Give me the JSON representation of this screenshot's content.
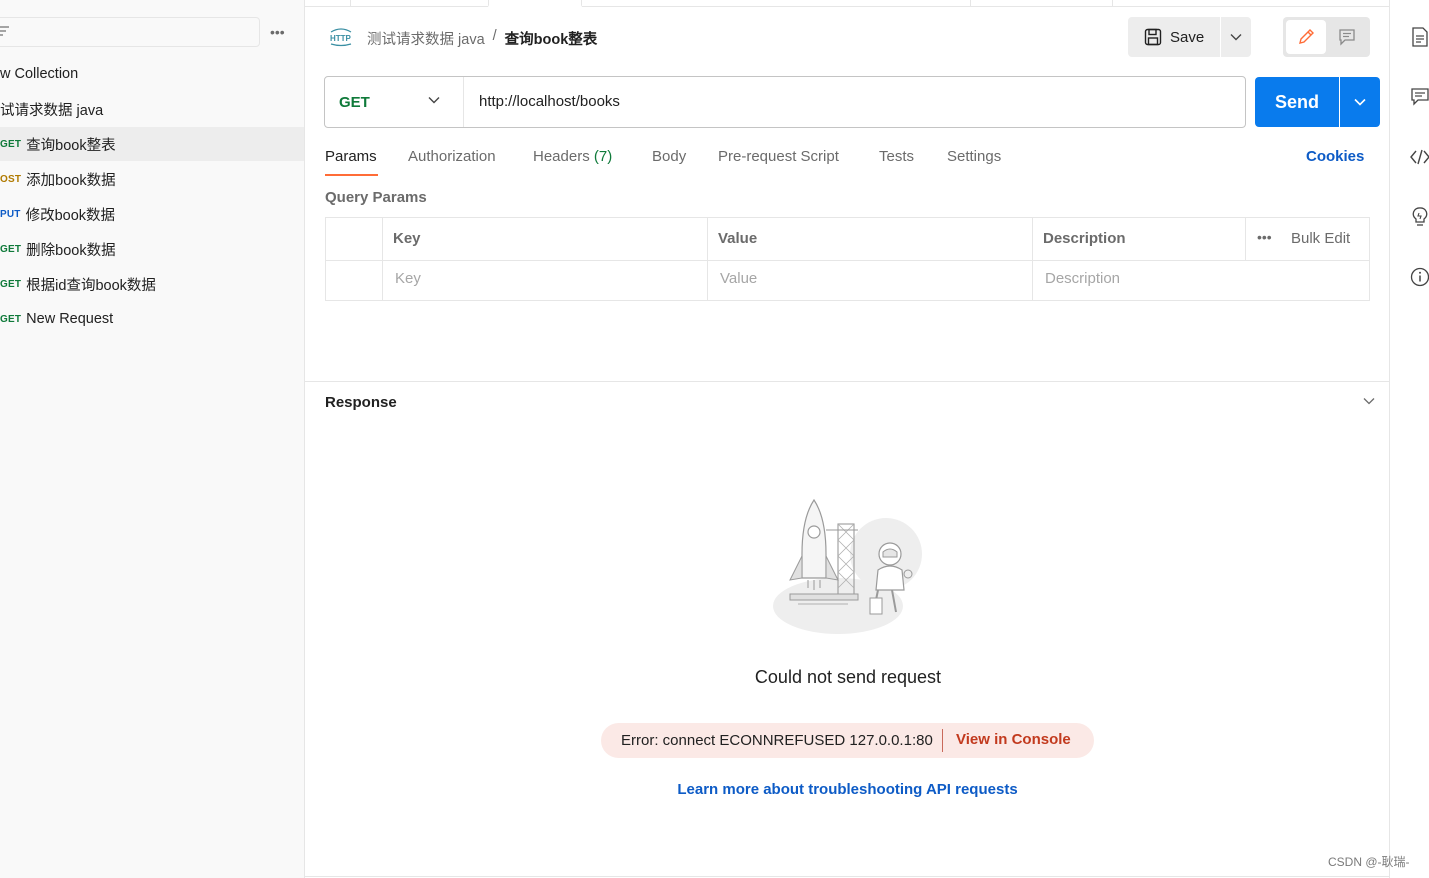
{
  "sidebar": {
    "more_label": "•••",
    "items": [
      {
        "method": "",
        "label": "w Collection"
      },
      {
        "method": "",
        "label": "试请求数据 java"
      },
      {
        "method": "GET",
        "label": "查询book整表"
      },
      {
        "method": "OST",
        "label": "添加book数据"
      },
      {
        "method": "PUT",
        "label": "修改book数据"
      },
      {
        "method": "GET",
        "label": "删除book数据"
      },
      {
        "method": "GET",
        "label": "根据id查询book数据"
      },
      {
        "method": "GET",
        "label": "New Request"
      }
    ]
  },
  "header": {
    "http_icon": "http-request-icon",
    "breadcrumb_parent": "测试请求数据 java",
    "breadcrumb_separator": "/",
    "breadcrumb_current": "查询book整表",
    "save_label": "Save"
  },
  "request": {
    "method": "GET",
    "url": "http://localhost/books",
    "send_label": "Send",
    "tabs": {
      "params": "Params",
      "authorization": "Authorization",
      "headers": "Headers",
      "headers_count": "(7)",
      "body": "Body",
      "pre_request": "Pre-request Script",
      "tests": "Tests",
      "settings": "Settings"
    },
    "cookies_label": "Cookies"
  },
  "query_params": {
    "title": "Query Params",
    "headers": {
      "key": "Key",
      "value": "Value",
      "description": "Description"
    },
    "placeholders": {
      "key": "Key",
      "value": "Value",
      "description": "Description"
    },
    "more_label": "•••",
    "bulk_edit": "Bulk Edit"
  },
  "response": {
    "title": "Response",
    "error_title": "Could not send request",
    "error_message": "Error: connect ECONNREFUSED 127.0.0.1:80",
    "view_console": "View in Console",
    "learn_more": "Learn more about troubleshooting API requests"
  },
  "watermark": "CSDN @-耿瑞-",
  "colors": {
    "accent_orange": "#ff6c37",
    "send_blue": "#097bed",
    "get_green": "#0f7a3a",
    "post_amber": "#b07a00",
    "put_blue": "#0d5bc6",
    "error_red": "#c23a1e",
    "link_blue": "#0d5bc6"
  }
}
